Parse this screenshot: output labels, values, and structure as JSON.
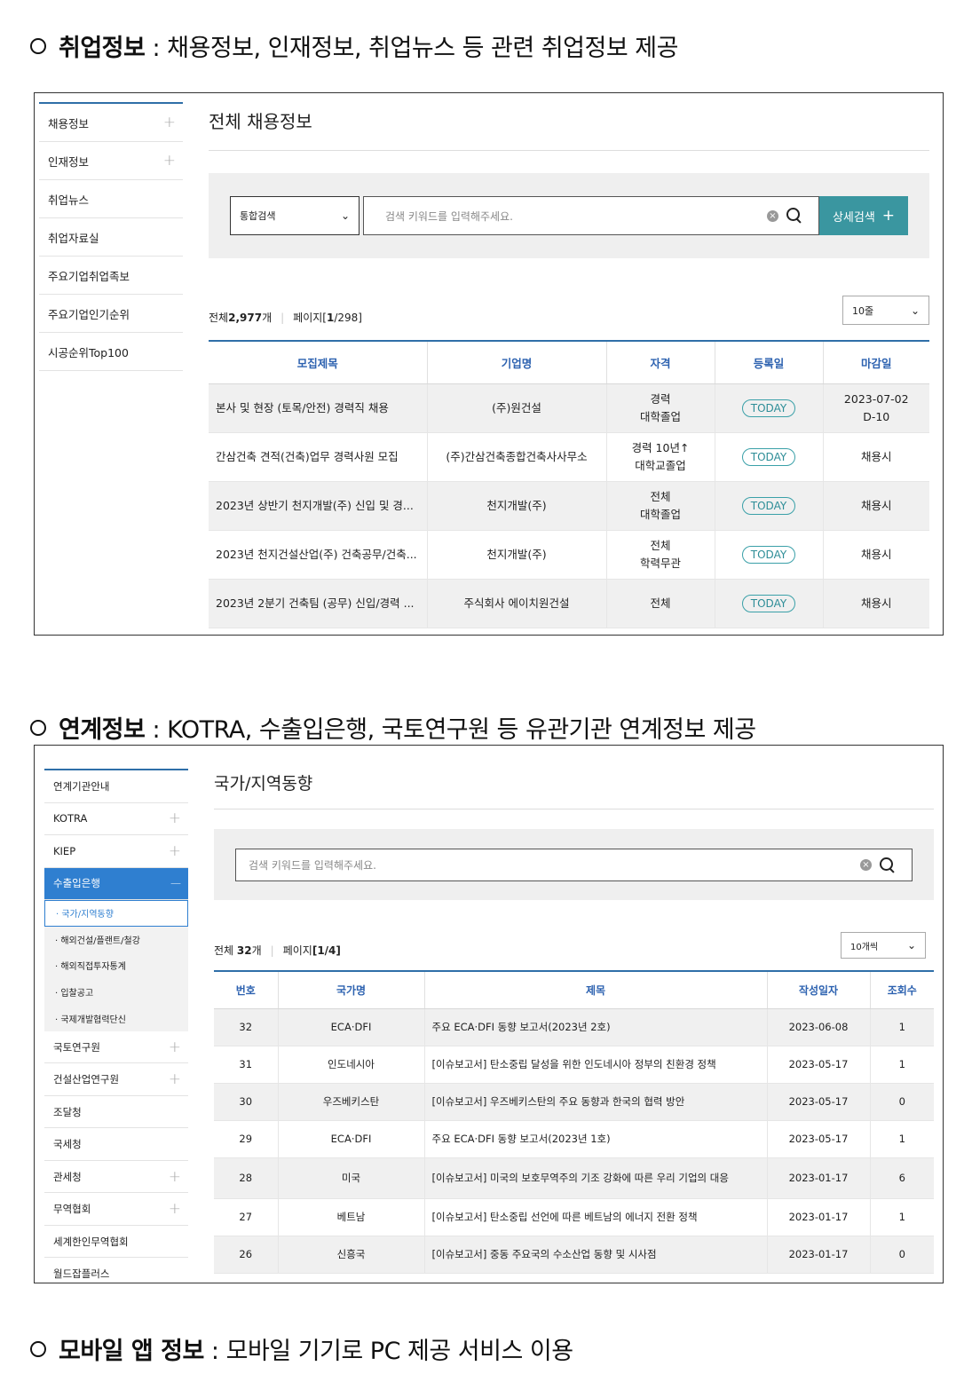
{
  "section1": {
    "heading_bold": "취업정보",
    "heading_rest": " : 채용정보, 인재정보, 취업뉴스 등 관련 취업정보 제공",
    "sidebar": [
      {
        "label": "채용정보",
        "plus": true
      },
      {
        "label": "인재정보",
        "plus": true
      },
      {
        "label": "취업뉴스",
        "plus": false
      },
      {
        "label": "취업자료실",
        "plus": false
      },
      {
        "label": "주요기업취업족보",
        "plus": false
      },
      {
        "label": "주요기업인기순위",
        "plus": false
      },
      {
        "label": "시공순위Top100",
        "plus": false
      }
    ],
    "page_title": "전체 채용정보",
    "search": {
      "select_value": "통합검색",
      "placeholder": "검색 키워드를 입력해주세요.",
      "detail_button": "상세검색"
    },
    "count_prefix": "전체",
    "count_value": "2,977",
    "count_unit": "개",
    "page_label": "페이지",
    "page_open": "[",
    "page_current": "1",
    "page_total": "/298]",
    "rows_select": "10줄",
    "columns": [
      "모집제목",
      "기업명",
      "자격",
      "등록일",
      "마감일"
    ],
    "rows": [
      {
        "title": "본사 및 현장 (토목/안전) 경력직 채용",
        "company": "(주)원건설",
        "qual1": "경력",
        "qual2": "대학졸업",
        "reg": "TODAY",
        "deadline1": "2023-07-02",
        "deadline2": "D-10"
      },
      {
        "title": "간삼건축 견적(건축)업무 경력사원 모집",
        "company": "(주)간삼건축종합건축사사무소",
        "qual1": "경력 10년↑",
        "qual2": "대학교졸업",
        "reg": "TODAY",
        "deadline1": "채용시",
        "deadline2": ""
      },
      {
        "title": "2023년 상반기 천지개발(주) 신입 및 경...",
        "company": "천지개발(주)",
        "qual1": "전체",
        "qual2": "대학졸업",
        "reg": "TODAY",
        "deadline1": "채용시",
        "deadline2": ""
      },
      {
        "title": "2023년 천지건설산업(주) 건축공무/건축...",
        "company": "천지개발(주)",
        "qual1": "전체",
        "qual2": "학력무관",
        "reg": "TODAY",
        "deadline1": "채용시",
        "deadline2": ""
      },
      {
        "title": "2023년 2분기 건축팀 (공무) 신입/경력 ...",
        "company": "주식회사 에이치원건설",
        "qual1": "전체",
        "qual2": "",
        "reg": "TODAY",
        "deadline1": "채용시",
        "deadline2": ""
      }
    ]
  },
  "section2": {
    "heading_bold": "연계정보",
    "heading_rest": " : KOTRA, 수출입은행, 국토연구원 등 유관기관 연계정보 제공",
    "sidebar": [
      {
        "label": "연계기관안내",
        "plus": false
      },
      {
        "label": "KOTRA",
        "plus": true
      },
      {
        "label": "KIEP",
        "plus": true
      },
      {
        "label": "수출입은행",
        "plus": false,
        "active": true
      }
    ],
    "subitems": [
      {
        "label": "· 국가/지역동향",
        "selected": true
      },
      {
        "label": "· 해외건설/플랜트/철강",
        "selected": false
      },
      {
        "label": "· 해외직접투자통계",
        "selected": false
      },
      {
        "label": "· 입찰공고",
        "selected": false
      },
      {
        "label": "· 국제개발협력단신",
        "selected": false
      }
    ],
    "sidebar_rest": [
      {
        "label": "국토연구원",
        "plus": true
      },
      {
        "label": "건설산업연구원",
        "plus": true
      },
      {
        "label": "조달청",
        "plus": false
      },
      {
        "label": "국세청",
        "plus": false
      },
      {
        "label": "관세청",
        "plus": true
      },
      {
        "label": "무역협회",
        "plus": true
      },
      {
        "label": "세계한인무역협회",
        "plus": false
      },
      {
        "label": "월드잡플러스",
        "plus": false
      }
    ],
    "page_title": "국가/지역동향",
    "search_placeholder": "검색 키워드를 입력해주세요.",
    "count_prefix": "전체",
    "count_value": "32",
    "count_unit": "개",
    "page_label": "페이지",
    "page_info": "[1/4]",
    "rows_select": "10개씩",
    "columns": [
      "번호",
      "국가명",
      "제목",
      "작성일자",
      "조회수"
    ],
    "rows": [
      {
        "no": "32",
        "country": "ECA·DFI",
        "title": "주요 ECA·DFI 동향 보고서(2023년 2호)",
        "date": "2023-06-08",
        "views": "1"
      },
      {
        "no": "31",
        "country": "인도네시아",
        "title": "[이슈보고서] 탄소중립 달성을 위한 인도네시아 정부의 친환경 정책",
        "date": "2023-05-17",
        "views": "1"
      },
      {
        "no": "30",
        "country": "우즈베키스탄",
        "title": "[이슈보고서] 우즈베키스탄의 주요 동향과 한국의 협력 방안",
        "date": "2023-05-17",
        "views": "0"
      },
      {
        "no": "29",
        "country": "ECA·DFI",
        "title": "주요 ECA·DFI 동향 보고서(2023년 1호)",
        "date": "2023-05-17",
        "views": "1"
      },
      {
        "no": "28",
        "country": "미국",
        "title": "[이슈보고서] 미국의 보호무역주의 기조 강화에 따른 우리 기업의 대응",
        "date": "2023-01-17",
        "views": "6"
      },
      {
        "no": "27",
        "country": "베트남",
        "title": "[이슈보고서] 탄소중립 선언에 따른 베트남의 에너지 전환 정책",
        "date": "2023-01-17",
        "views": "1"
      },
      {
        "no": "26",
        "country": "신흥국",
        "title": "[이슈보고서] 중동 주요국의 수소산업 동향 및 시사점",
        "date": "2023-01-17",
        "views": "0"
      }
    ]
  },
  "section3": {
    "heading_bold": "모바일 앱 정보",
    "heading_rest": " : 모바일 기기로 PC 제공 서비스 이용"
  }
}
